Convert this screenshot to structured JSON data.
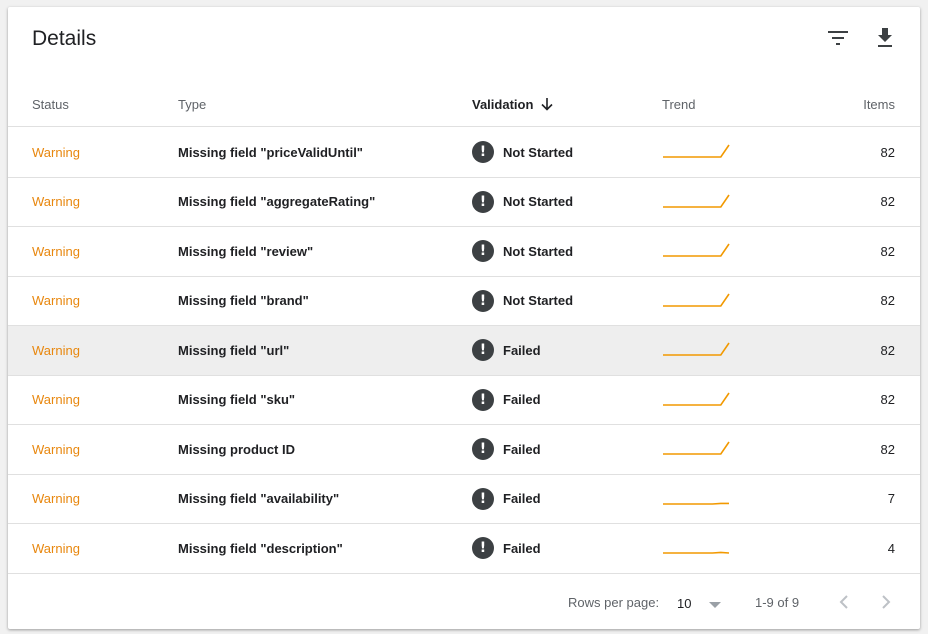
{
  "header": {
    "title": "Details",
    "filter_icon": "filter-icon",
    "download_icon": "download-icon"
  },
  "columns": {
    "status": "Status",
    "type": "Type",
    "validation": "Validation",
    "trend": "Trend",
    "items": "Items"
  },
  "rows": [
    {
      "status": "Warning",
      "type": "Missing field \"priceValidUntil\"",
      "validation": "Not Started",
      "items": "82",
      "trend": [
        0,
        0,
        0,
        0,
        0,
        0,
        0,
        0,
        1
      ]
    },
    {
      "status": "Warning",
      "type": "Missing field \"aggregateRating\"",
      "validation": "Not Started",
      "items": "82",
      "trend": [
        0,
        0,
        0,
        0,
        0,
        0,
        0,
        0,
        1
      ]
    },
    {
      "status": "Warning",
      "type": "Missing field \"review\"",
      "validation": "Not Started",
      "items": "82",
      "trend": [
        0,
        0,
        0,
        0,
        0,
        0,
        0,
        0,
        1
      ]
    },
    {
      "status": "Warning",
      "type": "Missing field \"brand\"",
      "validation": "Not Started",
      "items": "82",
      "trend": [
        0,
        0,
        0,
        0,
        0,
        0,
        0,
        0,
        1
      ]
    },
    {
      "status": "Warning",
      "type": "Missing field \"url\"",
      "validation": "Failed",
      "items": "82",
      "trend": [
        0,
        0,
        0,
        0,
        0,
        0,
        0,
        0,
        1
      ]
    },
    {
      "status": "Warning",
      "type": "Missing field \"sku\"",
      "validation": "Failed",
      "items": "82",
      "trend": [
        0,
        0,
        0,
        0,
        0,
        0,
        0,
        0,
        1
      ]
    },
    {
      "status": "Warning",
      "type": "Missing product ID",
      "validation": "Failed",
      "items": "82",
      "trend": [
        0,
        0,
        0,
        0,
        0,
        0,
        0,
        0,
        1
      ]
    },
    {
      "status": "Warning",
      "type": "Missing field \"availability\"",
      "validation": "Failed",
      "items": "7",
      "trend": [
        0,
        0,
        0,
        0,
        0,
        0,
        0,
        0.05,
        0.05
      ]
    },
    {
      "status": "Warning",
      "type": "Missing field \"description\"",
      "validation": "Failed",
      "items": "4",
      "trend": [
        0,
        0,
        0,
        0,
        0,
        0,
        0,
        0.05,
        0
      ]
    }
  ],
  "highlight_row": 4,
  "footer": {
    "rows_per_page_label": "Rows per page:",
    "rows_per_page_value": "10",
    "range": "1-9 of 9"
  },
  "colors": {
    "warning": "#e8870e",
    "trend_line": "#f29900",
    "validation_icon": "#3c4043"
  }
}
